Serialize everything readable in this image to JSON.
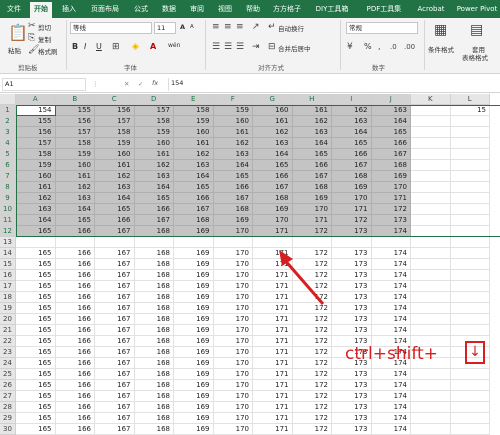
{
  "ribbon_tabs": [
    "文件",
    "开始",
    "插入",
    "页面布局",
    "公式",
    "数据",
    "审阅",
    "视图",
    "帮助",
    "方方格子",
    "DIY工具箱",
    "PDF工具集",
    "Acrobat",
    "Power Pivot"
  ],
  "active_tab": "开始",
  "clipboard": {
    "paste": "粘贴",
    "cut": "剪切",
    "copy": "复制",
    "format_painter": "格式刷",
    "group": "剪贴板"
  },
  "font": {
    "name": "等线",
    "size": "11",
    "group": "字体",
    "bold": "B",
    "italic": "I",
    "underline": "U",
    "grow": "A",
    "shrink": "A",
    "font_color": "A",
    "wen": "wén"
  },
  "alignment": {
    "wrap": "自动换行",
    "merge": "合并后居中",
    "group": "对齐方式"
  },
  "number": {
    "format": "常规",
    "percent": "%",
    "comma": ",",
    "group": "数字"
  },
  "styles": {
    "conditional": "条件格式",
    "table_line1": "套用",
    "table_line2": "表格格式"
  },
  "formula_bar": {
    "name_box": "A1",
    "fx": "fx",
    "value": "154",
    "cancel": "✕",
    "confirm": "✓"
  },
  "columns": [
    "A",
    "B",
    "C",
    "D",
    "E",
    "F",
    "G",
    "H",
    "I",
    "J",
    "K",
    "L"
  ],
  "row_numbers": [
    "1",
    "2",
    "3",
    "4",
    "5",
    "6",
    "7",
    "8",
    "9",
    "10",
    "11",
    "12",
    "13",
    "14",
    "15",
    "16",
    "17",
    "18",
    "19",
    "20",
    "21",
    "22",
    "23",
    "24",
    "25",
    "26",
    "27",
    "28",
    "29",
    "30"
  ],
  "rows": [
    [
      "154",
      "155",
      "156",
      "157",
      "158",
      "159",
      "160",
      "161",
      "162",
      "163"
    ],
    [
      "155",
      "156",
      "157",
      "158",
      "159",
      "160",
      "161",
      "162",
      "163",
      "164"
    ],
    [
      "156",
      "157",
      "158",
      "159",
      "160",
      "161",
      "162",
      "163",
      "164",
      "165"
    ],
    [
      "157",
      "158",
      "159",
      "160",
      "161",
      "162",
      "163",
      "164",
      "165",
      "166"
    ],
    [
      "158",
      "159",
      "160",
      "161",
      "162",
      "163",
      "164",
      "165",
      "166",
      "167"
    ],
    [
      "159",
      "160",
      "161",
      "162",
      "163",
      "164",
      "165",
      "166",
      "167",
      "168"
    ],
    [
      "160",
      "161",
      "162",
      "163",
      "164",
      "165",
      "166",
      "167",
      "168",
      "169"
    ],
    [
      "161",
      "162",
      "163",
      "164",
      "165",
      "166",
      "167",
      "168",
      "169",
      "170"
    ],
    [
      "162",
      "163",
      "164",
      "165",
      "166",
      "167",
      "168",
      "169",
      "170",
      "171"
    ],
    [
      "163",
      "164",
      "165",
      "166",
      "167",
      "168",
      "169",
      "170",
      "171",
      "172"
    ],
    [
      "164",
      "165",
      "166",
      "167",
      "168",
      "169",
      "170",
      "171",
      "172",
      "173"
    ],
    [
      "165",
      "166",
      "167",
      "168",
      "169",
      "170",
      "171",
      "172",
      "173",
      "174"
    ],
    [],
    [
      "165",
      "166",
      "167",
      "168",
      "169",
      "170",
      "171",
      "172",
      "173",
      "174"
    ],
    [
      "165",
      "166",
      "167",
      "168",
      "169",
      "170",
      "171",
      "172",
      "173",
      "174"
    ],
    [
      "165",
      "166",
      "167",
      "168",
      "169",
      "170",
      "171",
      "172",
      "173",
      "174"
    ],
    [
      "165",
      "166",
      "167",
      "168",
      "169",
      "170",
      "171",
      "172",
      "173",
      "174"
    ],
    [
      "165",
      "166",
      "167",
      "168",
      "169",
      "170",
      "171",
      "172",
      "173",
      "174"
    ],
    [
      "165",
      "166",
      "167",
      "168",
      "169",
      "170",
      "171",
      "172",
      "173",
      "174"
    ],
    [
      "165",
      "166",
      "167",
      "168",
      "169",
      "170",
      "171",
      "172",
      "173",
      "174"
    ],
    [
      "165",
      "166",
      "167",
      "168",
      "169",
      "170",
      "171",
      "172",
      "173",
      "174"
    ],
    [
      "165",
      "166",
      "167",
      "168",
      "169",
      "170",
      "171",
      "172",
      "173",
      "174"
    ],
    [
      "165",
      "166",
      "167",
      "168",
      "169",
      "170",
      "171",
      "172",
      "173",
      "174"
    ],
    [
      "165",
      "166",
      "167",
      "168",
      "169",
      "170",
      "171",
      "172",
      "173",
      "174"
    ],
    [
      "165",
      "166",
      "167",
      "168",
      "169",
      "170",
      "171",
      "172",
      "173",
      "174"
    ],
    [
      "165",
      "166",
      "167",
      "168",
      "169",
      "170",
      "171",
      "172",
      "173",
      "174"
    ],
    [
      "165",
      "166",
      "167",
      "168",
      "169",
      "170",
      "171",
      "172",
      "173",
      "174"
    ],
    [
      "165",
      "166",
      "167",
      "168",
      "169",
      "170",
      "171",
      "172",
      "173",
      "174"
    ],
    [
      "165",
      "166",
      "167",
      "168",
      "169",
      "170",
      "171",
      "172",
      "173",
      "174"
    ],
    [
      "165",
      "166",
      "167",
      "168",
      "169",
      "170",
      "171",
      "172",
      "173",
      "174"
    ]
  ],
  "overflow_cell_L1": "15",
  "selected_rows": 12,
  "annotation": {
    "text": "ctrl+shift+",
    "key": "↓"
  },
  "colors": {
    "accent": "#217346",
    "selection": "#c4c4c4",
    "annotation": "#d81e1e"
  }
}
